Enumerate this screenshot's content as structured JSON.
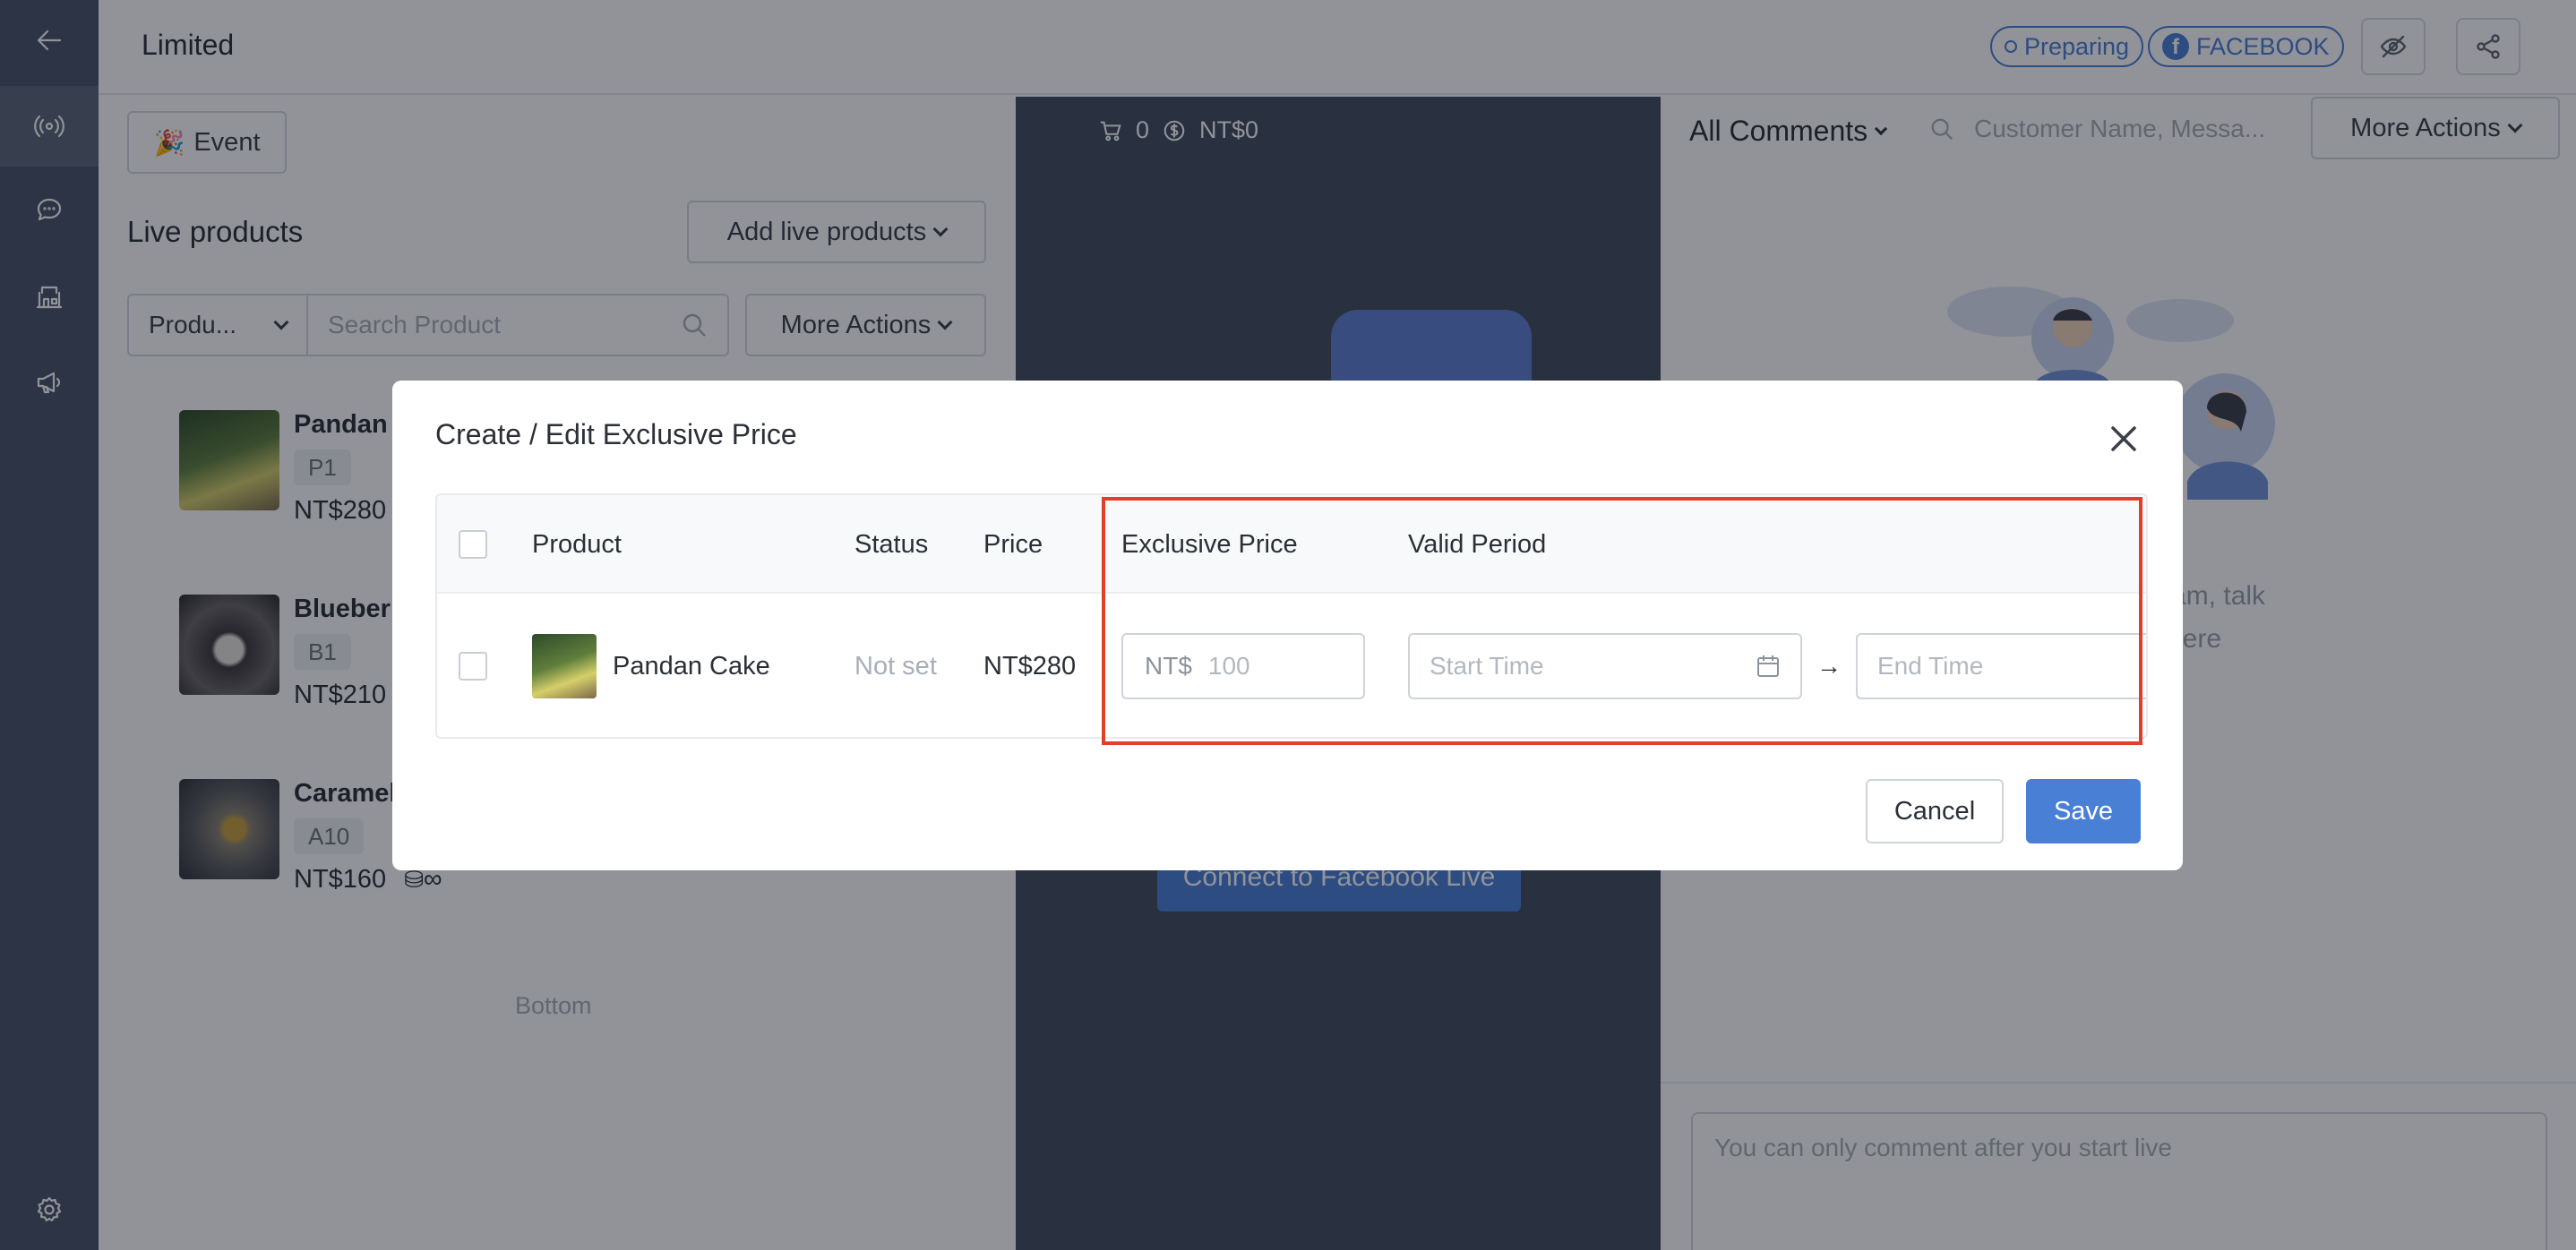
{
  "header": {
    "title": "Limited",
    "status_badge": "Preparing",
    "platform_badge": "FACEBOOK"
  },
  "left_panel": {
    "event_button": "Event",
    "section_title": "Live products",
    "add_button": "Add live products",
    "filter_select": "Produ...",
    "search_placeholder": "Search Product",
    "more_actions": "More Actions",
    "products": [
      {
        "name": "Pandan C",
        "code": "P1",
        "price": "NT$280"
      },
      {
        "name": "Blueberr",
        "code": "B1",
        "price": "NT$210"
      },
      {
        "name": "Caramel",
        "code": "A10",
        "price": "NT$160"
      }
    ],
    "stock_symbol": "∞",
    "bottom_note": "Bottom"
  },
  "middle_panel": {
    "cart_count": "0",
    "cart_total": "NT$0",
    "connect_button": "Connect to Facebook Live"
  },
  "right_panel": {
    "comments_filter": "All Comments",
    "search_placeholder": "Customer Name, Messa...",
    "more_actions": "More Actions",
    "empty_line1": "stream, talk",
    "empty_line2": "here",
    "comment_placeholder": "You can only comment after you start live"
  },
  "modal": {
    "title": "Create / Edit Exclusive Price",
    "columns": {
      "product": "Product",
      "status": "Status",
      "price": "Price",
      "exclusive_price": "Exclusive Price",
      "valid_period": "Valid Period"
    },
    "rows": [
      {
        "product": "Pandan Cake",
        "status": "Not set",
        "price": "NT$280",
        "currency_prefix": "NT$",
        "exclusive_price_placeholder": "100",
        "start_placeholder": "Start Time",
        "end_placeholder": "End Time"
      }
    ],
    "period_separator": "→",
    "cancel_button": "Cancel",
    "save_button": "Save"
  },
  "colors": {
    "accent": "#4a7fd6",
    "rail": "#4a5366",
    "highlight": "#e03f2a"
  }
}
